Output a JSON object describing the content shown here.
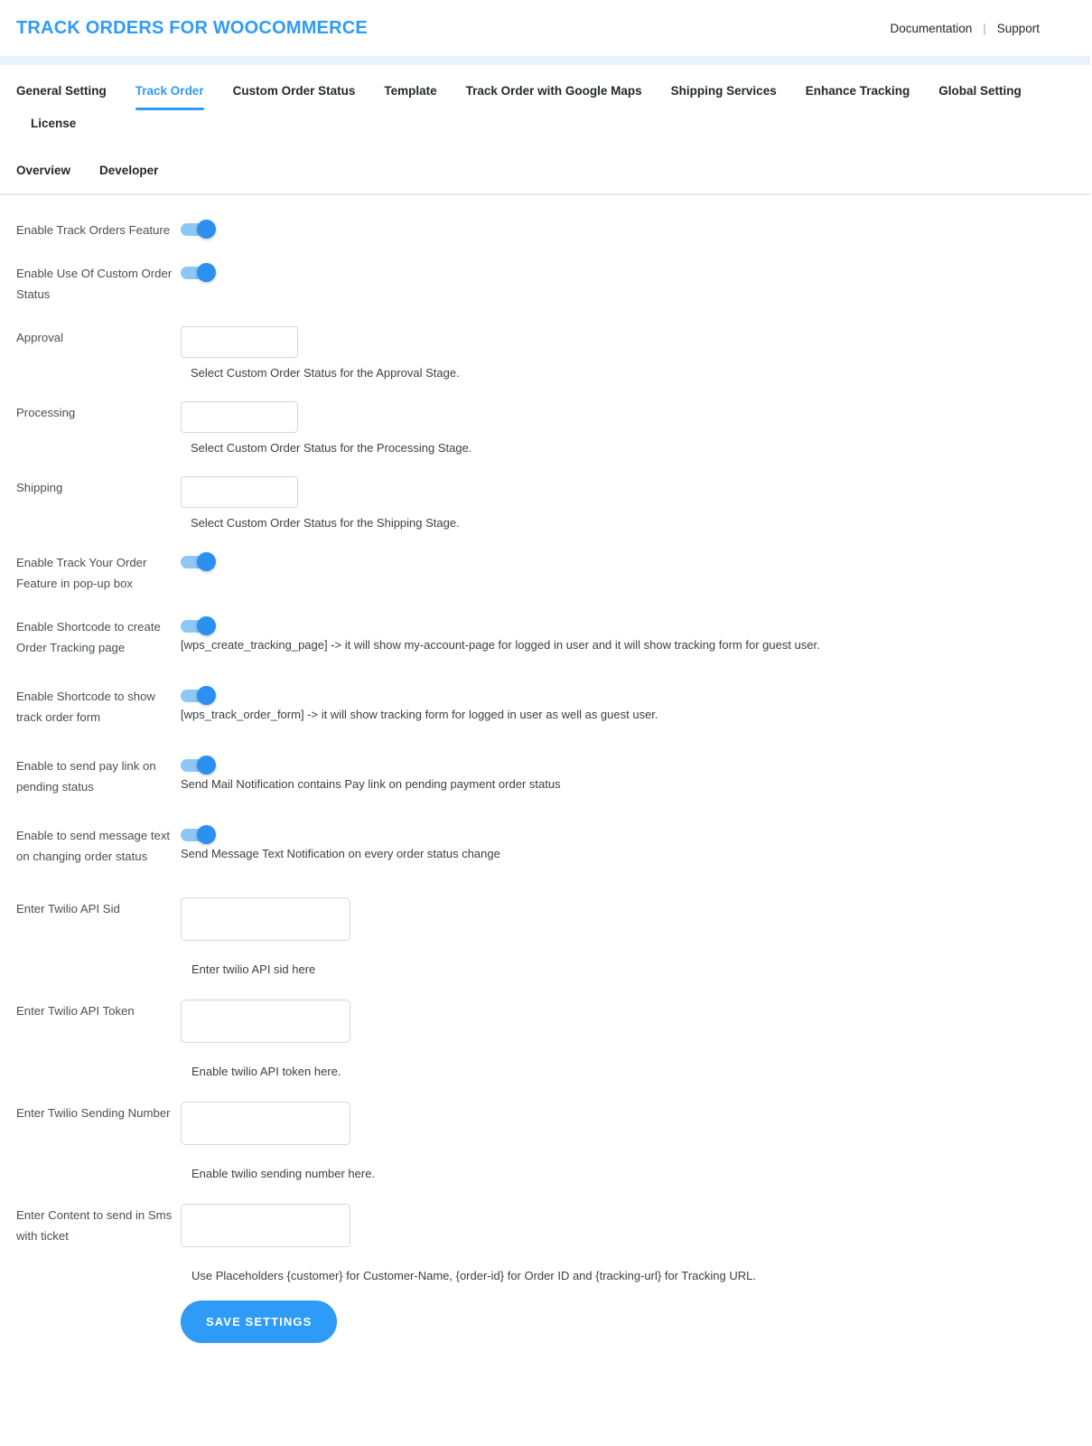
{
  "header": {
    "title": "TRACK ORDERS FOR WOOCOMMERCE",
    "links": {
      "documentation": "Documentation",
      "separator": "|",
      "support": "Support"
    },
    "accent_color": "#2e9bf7",
    "band_color": "#e7f2fd"
  },
  "tabs": {
    "row1": [
      {
        "label": "General Setting",
        "active": false
      },
      {
        "label": "Track Order",
        "active": true
      },
      {
        "label": "Custom Order Status",
        "active": false
      },
      {
        "label": "Template",
        "active": false
      },
      {
        "label": "Track Order with Google Maps",
        "active": false
      },
      {
        "label": "Shipping Services",
        "active": false
      },
      {
        "label": "Enhance Tracking",
        "active": false
      },
      {
        "label": "Global Setting",
        "active": false
      },
      {
        "label": "License",
        "active": false
      }
    ],
    "row2": [
      {
        "label": "Overview",
        "active": false
      },
      {
        "label": "Developer",
        "active": false
      }
    ]
  },
  "form": {
    "toggles": {
      "enable_track_orders": {
        "label": "Enable Track Orders Feature",
        "state": "on",
        "hint": ""
      },
      "enable_custom_order_status": {
        "label": "Enable Use Of Custom Order Status",
        "state": "on",
        "hint": ""
      },
      "enable_popup": {
        "label": "Enable Track Your Order Feature in pop-up box",
        "state": "on",
        "hint": ""
      },
      "enable_shortcode_tracking_page": {
        "label": "Enable Shortcode to create Order Tracking page",
        "state": "on",
        "hint": "[wps_create_tracking_page] -> it will show my-account-page for logged in user and it will show tracking form for guest user."
      },
      "enable_shortcode_track_form": {
        "label": "Enable Shortcode to show track order form",
        "state": "on",
        "hint": "[wps_track_order_form] -> it will show tracking form for logged in user as well as guest user."
      },
      "enable_pay_link": {
        "label": "Enable to send pay link on pending status",
        "state": "on",
        "hint": "Send Mail Notification contains Pay link on pending payment order status"
      },
      "enable_message_text": {
        "label": "Enable to send message text on changing order status",
        "state": "on",
        "hint": "Send Message Text Notification on every order status change"
      }
    },
    "selects": {
      "approval": {
        "label": "Approval",
        "value": "",
        "hint": "Select Custom Order Status for the Approval Stage."
      },
      "processing": {
        "label": "Processing",
        "value": "",
        "hint": "Select Custom Order Status for the Processing Stage."
      },
      "shipping": {
        "label": "Shipping",
        "value": "",
        "hint": "Select Custom Order Status for the Shipping Stage."
      }
    },
    "inputs": {
      "twilio_api_sid": {
        "label": "Enter Twilio API Sid",
        "value": "",
        "placeholder": "",
        "hint": "Enter twilio API sid here"
      },
      "twilio_api_token": {
        "label": "Enter Twilio API Token",
        "value": "",
        "placeholder": "",
        "hint": "Enable twilio API token here."
      },
      "twilio_sending_number": {
        "label": "Enter Twilio Sending Number",
        "value": "",
        "placeholder": "",
        "hint": "Enable twilio sending number here."
      },
      "sms_content": {
        "label": "Enter Content to send in Sms with ticket",
        "value": "",
        "placeholder": "",
        "hint": "Use Placeholders {customer} for Customer-Name, {order-id} for Order ID and {tracking-url} for Tracking URL."
      }
    },
    "save_button": "SAVE SETTINGS"
  }
}
